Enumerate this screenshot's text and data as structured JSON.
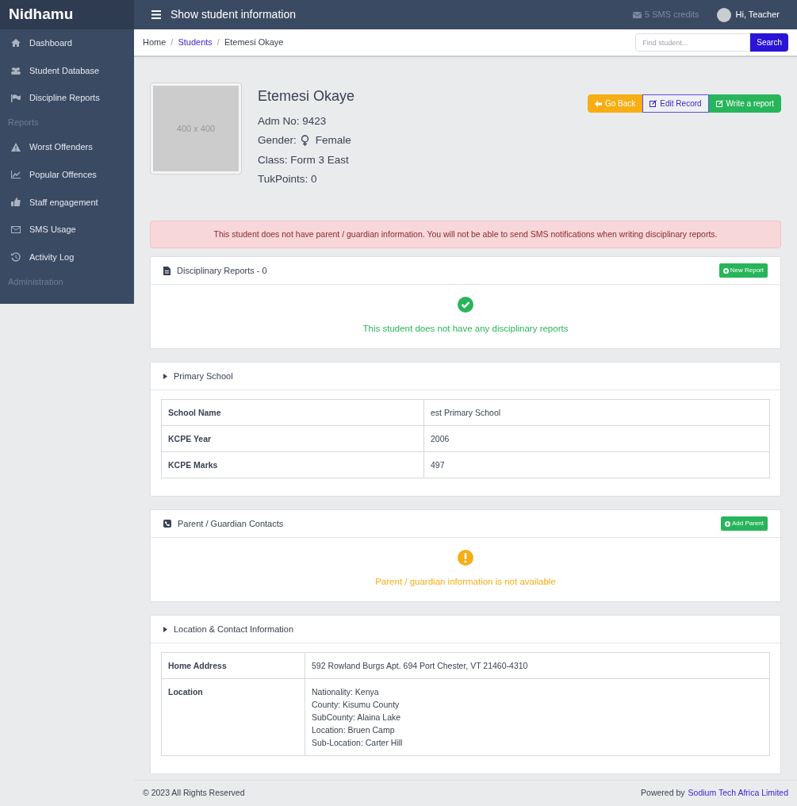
{
  "brand": "Nidhamu",
  "sidebar": {
    "items": [
      {
        "kind": "link",
        "label": "Dashboard"
      },
      {
        "kind": "link",
        "label": "Student Database"
      },
      {
        "kind": "link",
        "label": "Discipline Reports"
      },
      {
        "kind": "heading",
        "label": "Reports"
      },
      {
        "kind": "link",
        "label": "Worst Offenders"
      },
      {
        "kind": "link",
        "label": "Popular Offences"
      },
      {
        "kind": "link",
        "label": "Staff engagement"
      },
      {
        "kind": "link",
        "label": "SMS Usage"
      },
      {
        "kind": "link",
        "label": "Activity Log"
      },
      {
        "kind": "heading",
        "label": "Administration"
      }
    ]
  },
  "topbar": {
    "title": "Show student information",
    "sms_credits": "5 SMS credits",
    "user": "Hi, Teacher"
  },
  "breadcrumb": [
    {
      "kind": "text",
      "label": "Home"
    },
    {
      "kind": "separator",
      "label": "/"
    },
    {
      "kind": "link",
      "label": "Students"
    },
    {
      "kind": "separator",
      "label": "/"
    },
    {
      "kind": "text",
      "label": "Etemesi Okaye"
    }
  ],
  "search": {
    "placeholder": "Find student...",
    "button": "Search"
  },
  "student": {
    "photo_label": "400 x 400",
    "name": "Etemesi Okaye",
    "fields": [
      {
        "kind": "text",
        "label": "Adm No: 9423"
      },
      {
        "kind": "gender",
        "label": "Gender:",
        "value": "Female"
      },
      {
        "kind": "text",
        "label": "Class: Form 3 East"
      },
      {
        "kind": "text",
        "label": "TukPoints: 0"
      }
    ]
  },
  "actions": [
    {
      "label": "Go Back"
    },
    {
      "label": "Edit Record"
    },
    {
      "label": "Write a report"
    }
  ],
  "alert": "This student does not have parent / guardian information. You will not be able to send SMS notifications when writing disciplinary reports.",
  "panels": [
    {
      "kind": "cleared",
      "title": "Disciplinary Reports - 0",
      "button": "New Report",
      "message": "This student does not have any disciplinary reports"
    },
    {
      "kind": "table",
      "title": "Primary School",
      "rows": [
        [
          "School Name",
          "est Primary School"
        ],
        [
          "KCPE Year",
          "2006"
        ],
        [
          "KCPE Marks",
          "497"
        ]
      ]
    },
    {
      "kind": "missing",
      "title": "Parent / Guardian Contacts",
      "button": "Add Parent",
      "message": "Parent / guardian information is not available"
    },
    {
      "kind": "table",
      "title": "Location & Contact Information",
      "rows": [
        [
          "Home Address",
          "592 Rowland Burgs Apt. 694 Port Chester, VT 21460-4310"
        ],
        [
          "Location",
          "Nationality: Kenya\nCounty: Kisumu County\nSubCounty: Alaina Lake\nLocation: Bruen Camp\nSub-Location: Carter Hill"
        ]
      ]
    }
  ],
  "footer": {
    "copyright": "© 2023 All Rights Reserved",
    "powered_by": "Powered by",
    "company": "Sodium Tech Africa Limited"
  }
}
